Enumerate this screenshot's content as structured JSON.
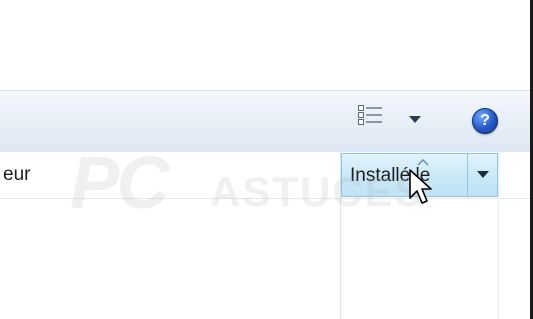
{
  "toolbar": {
    "view_icon": "details-view-icon",
    "dropdown_icon": "chevron-down-icon",
    "help_icon": "help-icon",
    "help_glyph": "?"
  },
  "columns": {
    "prev_header": "eur",
    "installed_header": "Installé le",
    "installed_sorted": "ascending"
  },
  "watermark": {
    "brand_prefix": "PC",
    "brand_suffix": "ASTUCES"
  },
  "colors": {
    "active_header": "#c9e8f7",
    "help_blue": "#2458c8"
  }
}
